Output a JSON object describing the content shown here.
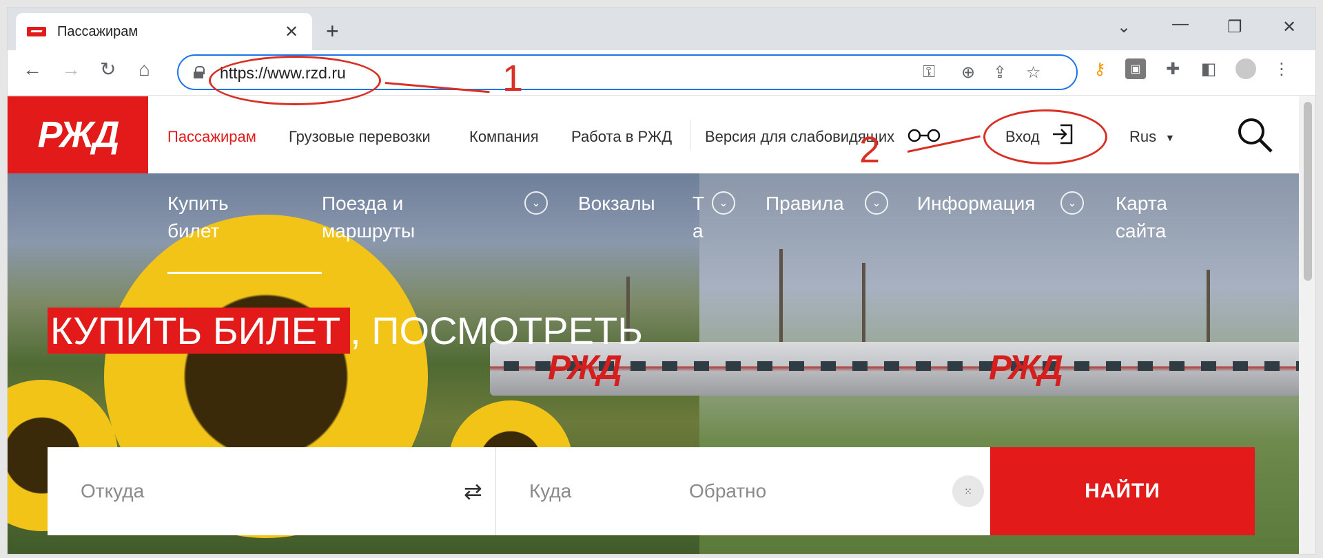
{
  "browser": {
    "tab_title": "Пассажирам",
    "tab_close": "✕",
    "new_tab": "+",
    "url": "https://www.rzd.ru",
    "window_controls": [
      "chevron-down",
      "minimize",
      "restore",
      "close"
    ]
  },
  "annotations": {
    "label_1": "1",
    "label_2": "2",
    "color": "#d93025"
  },
  "site": {
    "logo": "РЖД",
    "brand_color": "#e21a1a",
    "nav": [
      "Пассажирам",
      "Грузовые перевозки",
      "Компания",
      "Работа в РЖД",
      "Версия для слабовидящих"
    ],
    "login": "Вход",
    "lang": "Rus"
  },
  "hero": {
    "subnav": {
      "buy_1": "Купить",
      "buy_2": "билет",
      "trains_1": "Поезда и",
      "trains_2": "маршруты",
      "stations": "Вокзалы",
      "clipped_1": "Т",
      "clipped_2": "а",
      "rules": "Правила",
      "info": "Информация",
      "map_1": "Карта",
      "map_2": "сайта"
    },
    "headline_highlight": "КУПИТЬ БИЛЕТ",
    "headline_rest": ", ПОСМОТРЕТЬ",
    "train_mark": "РЖД"
  },
  "search": {
    "from": "Откуда",
    "to": "Куда",
    "back": "Обратно",
    "button": "НАЙТИ"
  }
}
